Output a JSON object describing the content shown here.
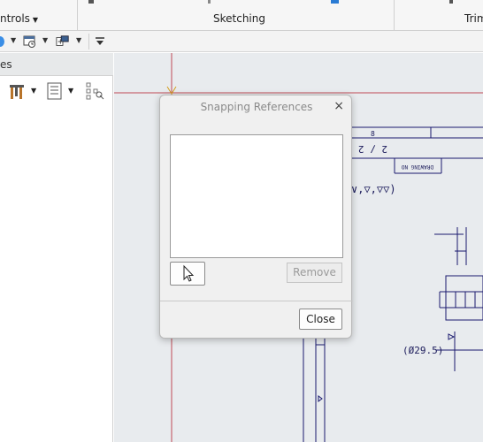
{
  "ribbon": {
    "groups": [
      {
        "label": "ntrols"
      },
      {
        "label": "Sketching"
      },
      {
        "label": "Trim"
      }
    ]
  },
  "panel": {
    "header": "es"
  },
  "drawing": {
    "sheet_num": "8",
    "sheet_of": "2 / 2",
    "drawing_no": "DRAWING NO",
    "surface_symbols": "∨,▽,▽▽)",
    "diameter": "(Ø29.5)"
  },
  "dialog": {
    "title": "Snapping References",
    "close_x": "×",
    "remove_label": "Remove",
    "close_label": "Close"
  },
  "colors": {
    "dialog_bg": "#f0f0f0",
    "canvas_bg": "#e8ebee",
    "sketch_line": "#1a1a6e",
    "datum_line": "#c04a55"
  }
}
